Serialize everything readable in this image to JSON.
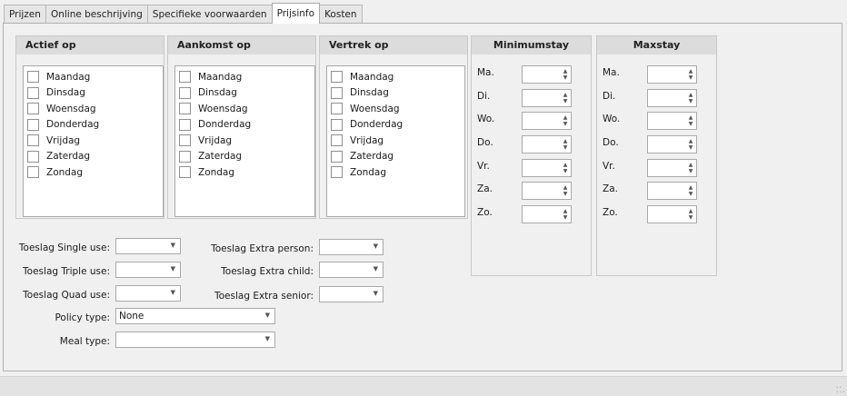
{
  "tabs": [
    {
      "label": "Prijzen"
    },
    {
      "label": "Online beschrijving"
    },
    {
      "label": "Specifieke voorwaarden"
    },
    {
      "label": "Prijsinfo"
    },
    {
      "label": "Kosten"
    }
  ],
  "active_tab": "Prijsinfo",
  "groups": {
    "actief": {
      "title": "Actief op"
    },
    "aankomst": {
      "title": "Aankomst op"
    },
    "vertrek": {
      "title": "Vertrek op"
    },
    "minimumstay": {
      "title": "Minimumstay"
    },
    "maxstay": {
      "title": "Maxstay"
    }
  },
  "days": [
    "Maandag",
    "Dinsdag",
    "Woensdag",
    "Donderdag",
    "Vrijdag",
    "Zaterdag",
    "Zondag"
  ],
  "day_abbr": [
    "Ma.",
    "Di.",
    "Wo.",
    "Do.",
    "Vr.",
    "Za.",
    "Zo."
  ],
  "fields": {
    "single_use": {
      "label": "Toeslag Single use:",
      "value": ""
    },
    "triple_use": {
      "label": "Toeslag Triple use:",
      "value": ""
    },
    "quad_use": {
      "label": "Toeslag Quad use:",
      "value": ""
    },
    "extra_person": {
      "label": "Toeslag Extra person:",
      "value": ""
    },
    "extra_child": {
      "label": "Toeslag Extra child:",
      "value": ""
    },
    "extra_senior": {
      "label": "Toeslag Extra senior:",
      "value": ""
    },
    "policy_type": {
      "label": "Policy type:",
      "value": "None"
    },
    "meal_type": {
      "label": "Meal type:",
      "value": ""
    }
  },
  "icons": {
    "dropdown": "chevron-down-icon",
    "spin": "spin-arrows-icon",
    "grip": "resize-grip-icon"
  }
}
